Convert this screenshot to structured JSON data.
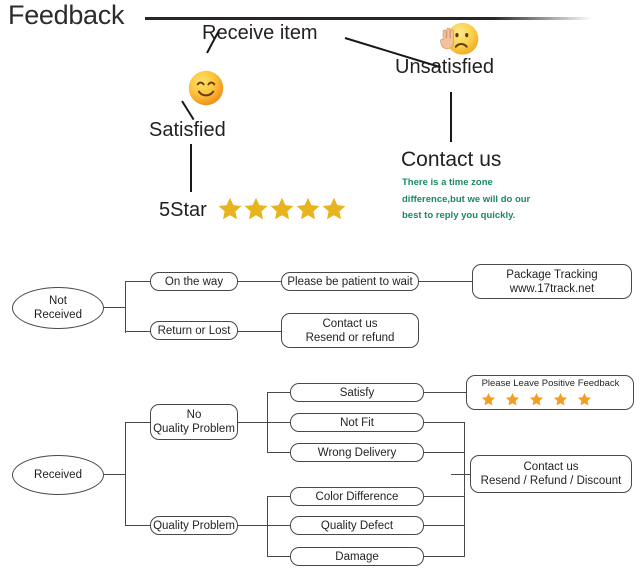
{
  "header": {
    "title": "Feedback"
  },
  "top_flow": {
    "receive_item": "Receive item",
    "unsatisfied": "Unsatisfied",
    "satisfied": "Satisfied",
    "contact_us_heading": "Contact us",
    "contact_us_note": "There is a time zone difference,but we will do our best to reply you quickly.",
    "five_star_label": "5Star",
    "five_star_count": 5,
    "satisfied_emoji": "smiling-face-with-smiling-eyes",
    "unsatisfied_emoji": "frowning-face-with-raised-hand"
  },
  "not_received_flow": {
    "root": "Not\nReceived",
    "root_line1": "Not",
    "root_line2": "Received",
    "branches": [
      {
        "label": "On the way",
        "next": "Please be patient to wait",
        "final_line1": "Package Tracking",
        "final_line2": "www.17track.net"
      },
      {
        "label": "Return or Lost",
        "next_line1": "Contact us",
        "next_line2": "Resend or refund"
      }
    ]
  },
  "received_flow": {
    "root": "Received",
    "groups": [
      {
        "label_line1": "No",
        "label_line2": "Quality Problem",
        "items": [
          "Satisfy",
          "Not Fit",
          "Wrong Delivery"
        ]
      },
      {
        "label_line1": "Quality Problem",
        "label_line2": "",
        "items": [
          "Color Difference",
          "Quality Defect",
          "Damage"
        ]
      }
    ],
    "positive_feedback": {
      "text": "Please Leave Positive Feedback",
      "star_count": 5
    },
    "resolution": {
      "line1": "Contact us",
      "line2": "Resend / Refund / Discount"
    }
  },
  "colors": {
    "star_gold": "#E8B41E",
    "star_orange": "#F59D1F",
    "note_green": "#1A8A5E",
    "stroke": "#4A4748",
    "text": "#231F20"
  }
}
